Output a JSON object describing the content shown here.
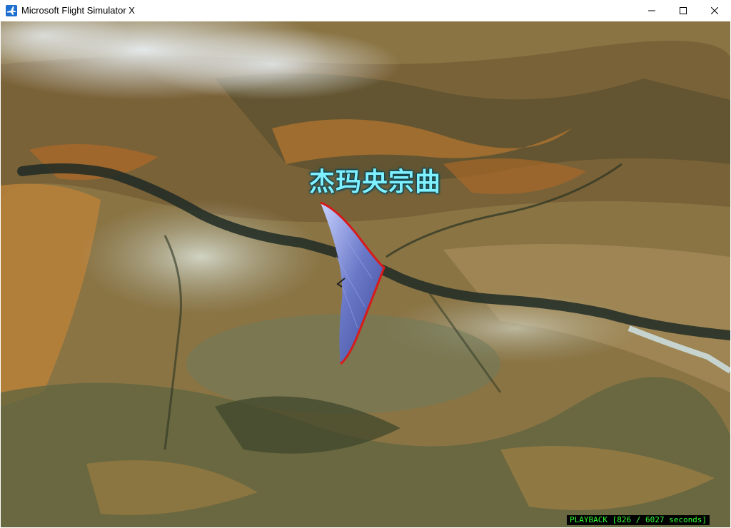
{
  "window": {
    "title": "Microsoft Flight Simulator X",
    "app_icon": "airplane-icon",
    "controls": [
      "minimize-icon",
      "maximize-icon",
      "close-icon"
    ]
  },
  "scene": {
    "overlay_text": "杰玛央宗曲",
    "overlay_color": "#7ff0ff",
    "aircraft": "hang-glider"
  },
  "status": {
    "playback": "PLAYBACK [826 / 6027 seconds]",
    "playback_color": "#33ff33"
  }
}
